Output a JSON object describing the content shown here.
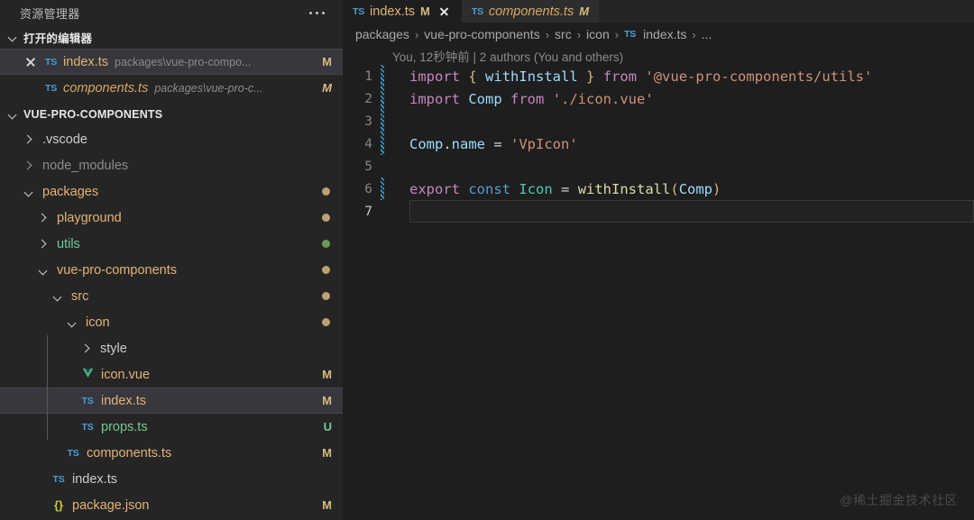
{
  "sidebar": {
    "title": "资源管理器",
    "more_actions": "more-actions",
    "open_editors": {
      "label": "打开的编辑器",
      "items": [
        {
          "name": "index.ts",
          "description": "packages\\vue-pro-compo...",
          "badge": "M",
          "icon": "ts-file-icon",
          "active": true,
          "italic": false,
          "name_color": "#e3b473",
          "badge_color": "#d7ba7d"
        },
        {
          "name": "components.ts",
          "description": "packages\\vue-pro-c...",
          "badge": "M",
          "icon": "ts-file-icon",
          "active": false,
          "italic": true,
          "name_color": "#d8a861",
          "badge_color": "#d7ba7d"
        }
      ]
    },
    "project": {
      "label": "VUE-PRO-COMPONENTS",
      "items": [
        {
          "name": ".vscode",
          "type": "folder",
          "state": "collapsed",
          "indent": 1,
          "color": "#cccccc",
          "badge": "",
          "dot": ""
        },
        {
          "name": "node_modules",
          "type": "folder",
          "state": "collapsed",
          "indent": 1,
          "color": "#8c8c8c",
          "badge": "",
          "dot": ""
        },
        {
          "name": "packages",
          "type": "folder",
          "state": "expanded",
          "indent": 1,
          "color": "#e3b473",
          "badge": "",
          "dot": "#bda271"
        },
        {
          "name": "playground",
          "type": "folder",
          "state": "collapsed",
          "indent": 2,
          "color": "#e3b473",
          "badge": "",
          "dot": "#bda271"
        },
        {
          "name": "utils",
          "type": "folder",
          "state": "collapsed",
          "indent": 2,
          "color": "#73c991",
          "badge": "",
          "dot": "#6a9955"
        },
        {
          "name": "vue-pro-components",
          "type": "folder",
          "state": "expanded",
          "indent": 2,
          "color": "#e3b473",
          "badge": "",
          "dot": "#bda271"
        },
        {
          "name": "src",
          "type": "folder",
          "state": "expanded",
          "indent": 3,
          "color": "#e3b473",
          "badge": "",
          "dot": "#bda271"
        },
        {
          "name": "icon",
          "type": "folder",
          "state": "expanded",
          "indent": 4,
          "color": "#e3b473",
          "badge": "",
          "dot": "#bda271"
        },
        {
          "name": "style",
          "type": "folder",
          "state": "collapsed",
          "indent": 5,
          "color": "#cccccc",
          "badge": "",
          "dot": ""
        },
        {
          "name": "icon.vue",
          "type": "vue",
          "state": "file",
          "indent": 5,
          "color": "#e3b473",
          "badge": "M",
          "badge_color": "#d7ba7d",
          "dot": ""
        },
        {
          "name": "index.ts",
          "type": "ts",
          "state": "file",
          "indent": 5,
          "color": "#e3b473",
          "badge": "M",
          "badge_color": "#d7ba7d",
          "dot": "",
          "selected": true
        },
        {
          "name": "props.ts",
          "type": "ts",
          "state": "file",
          "indent": 5,
          "color": "#73c991",
          "badge": "U",
          "badge_color": "#73c991",
          "dot": ""
        },
        {
          "name": "components.ts",
          "type": "ts",
          "state": "file",
          "indent": 4,
          "color": "#e3b473",
          "badge": "M",
          "badge_color": "#d7ba7d",
          "dot": ""
        },
        {
          "name": "index.ts",
          "type": "ts",
          "state": "file",
          "indent": 3,
          "color": "#cccccc",
          "badge": "",
          "dot": ""
        },
        {
          "name": "package.json",
          "type": "json",
          "state": "file",
          "indent": 3,
          "color": "#e3b473",
          "badge": "M",
          "badge_color": "#d7ba7d",
          "dot": ""
        }
      ]
    }
  },
  "editor": {
    "tabs": [
      {
        "name": "index.ts",
        "badge": "M",
        "active": true,
        "icon": "ts-file-icon",
        "closable": true
      },
      {
        "name": "components.ts",
        "badge": "M",
        "active": false,
        "icon": "ts-file-icon",
        "closable": false
      }
    ],
    "breadcrumb": [
      "packages",
      "vue-pro-components",
      "src",
      "icon",
      "index.ts",
      "..."
    ],
    "breadcrumb_separator": "›",
    "blame": "You, 12秒钟前 | 2 authors (You and others)",
    "current_line": 7,
    "lines": [
      {
        "n": 1,
        "changed": true,
        "tokens": [
          {
            "t": "import",
            "c": "t-kw"
          },
          {
            "t": " ",
            "c": "t-pl"
          },
          {
            "t": "{",
            "c": "t-br"
          },
          {
            "t": " ",
            "c": "t-pl"
          },
          {
            "t": "withInstall",
            "c": "t-var"
          },
          {
            "t": " ",
            "c": "t-pl"
          },
          {
            "t": "}",
            "c": "t-br"
          },
          {
            "t": " ",
            "c": "t-pl"
          },
          {
            "t": "from",
            "c": "t-kw"
          },
          {
            "t": " ",
            "c": "t-pl"
          },
          {
            "t": "'@vue-pro-components/utils'",
            "c": "t-str"
          }
        ]
      },
      {
        "n": 2,
        "changed": true,
        "tokens": [
          {
            "t": "import",
            "c": "t-kw"
          },
          {
            "t": " ",
            "c": "t-pl"
          },
          {
            "t": "Comp",
            "c": "t-var"
          },
          {
            "t": " ",
            "c": "t-pl"
          },
          {
            "t": "from",
            "c": "t-kw"
          },
          {
            "t": " ",
            "c": "t-pl"
          },
          {
            "t": "'./icon.vue'",
            "c": "t-str"
          }
        ]
      },
      {
        "n": 3,
        "changed": true,
        "tokens": []
      },
      {
        "n": 4,
        "changed": true,
        "tokens": [
          {
            "t": "Comp",
            "c": "t-var"
          },
          {
            "t": ".",
            "c": "t-pl"
          },
          {
            "t": "name",
            "c": "t-prop"
          },
          {
            "t": " = ",
            "c": "t-pl"
          },
          {
            "t": "'VpIcon'",
            "c": "t-str"
          }
        ]
      },
      {
        "n": 5,
        "changed": false,
        "tokens": []
      },
      {
        "n": 6,
        "changed": true,
        "tokens": [
          {
            "t": "export",
            "c": "t-kw"
          },
          {
            "t": " ",
            "c": "t-pl"
          },
          {
            "t": "const",
            "c": "t-kw2"
          },
          {
            "t": " ",
            "c": "t-pl"
          },
          {
            "t": "Icon",
            "c": "t-ty"
          },
          {
            "t": " = ",
            "c": "t-pl"
          },
          {
            "t": "withInstall",
            "c": "t-fn"
          },
          {
            "t": "(",
            "c": "t-br"
          },
          {
            "t": "Comp",
            "c": "t-var"
          },
          {
            "t": ")",
            "c": "t-br"
          }
        ]
      },
      {
        "n": 7,
        "changed": false,
        "tokens": []
      }
    ],
    "watermark": "@稀土掘金技术社区"
  }
}
